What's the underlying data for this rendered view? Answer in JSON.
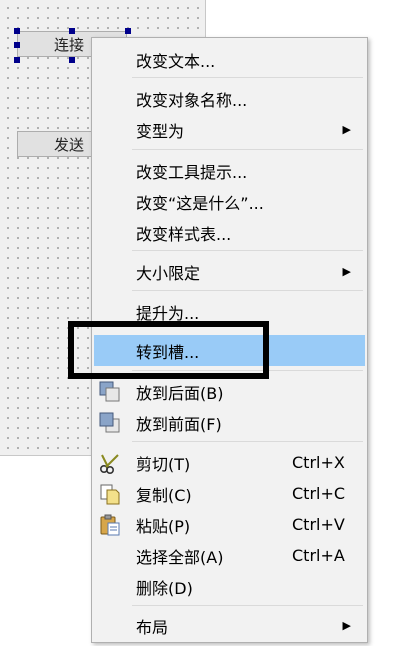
{
  "form": {
    "buttons": [
      {
        "label": "连接"
      },
      {
        "label": "发送"
      }
    ]
  },
  "context_menu": {
    "items": [
      {
        "label": "改变文本..."
      },
      {
        "label": "改变对象名称..."
      },
      {
        "label": "变型为",
        "submenu": true
      },
      {
        "label": "改变工具提示..."
      },
      {
        "label": "改变“这是什么”..."
      },
      {
        "label": "改变样式表..."
      },
      {
        "label": "大小限定",
        "submenu": true
      },
      {
        "label": "提升为..."
      },
      {
        "label": "转到槽...",
        "highlighted": true
      },
      {
        "label": "放到后面(B)",
        "icon": "send-to-back-icon"
      },
      {
        "label": "放到前面(F)",
        "icon": "bring-to-front-icon"
      },
      {
        "label": "剪切(T)",
        "shortcut": "Ctrl+X",
        "icon": "scissors-icon"
      },
      {
        "label": "复制(C)",
        "shortcut": "Ctrl+C",
        "icon": "copy-icon"
      },
      {
        "label": "粘贴(P)",
        "shortcut": "Ctrl+V",
        "icon": "paste-icon"
      },
      {
        "label": "选择全部(A)",
        "shortcut": "Ctrl+A"
      },
      {
        "label": "删除(D)"
      },
      {
        "label": "布局",
        "submenu": true
      }
    ],
    "submenu_arrow": "▶"
  },
  "colors": {
    "highlight": "#99cbf7",
    "menu_bg": "#f2f2f2",
    "annotation": "#000000",
    "selection_handle": "#00008b"
  }
}
